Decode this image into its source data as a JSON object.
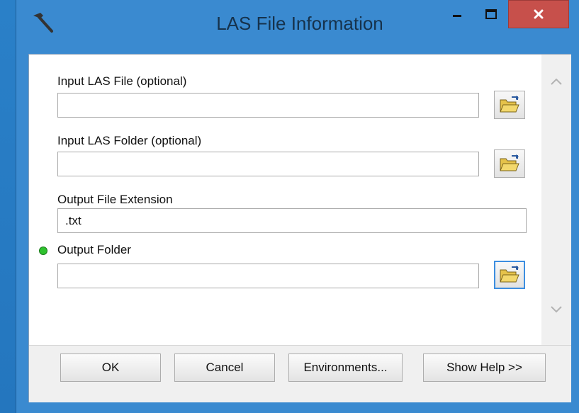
{
  "window": {
    "title": "LAS File Information"
  },
  "params": [
    {
      "label": "Input LAS File (optional)",
      "value": ""
    },
    {
      "label": "Input LAS Folder (optional)",
      "value": ""
    },
    {
      "label": "Output File Extension",
      "value": ".txt"
    },
    {
      "label": "Output Folder",
      "value": "",
      "required": true
    }
  ],
  "buttons": {
    "ok": "OK",
    "cancel": "Cancel",
    "environments": "Environments...",
    "show_help": "Show Help >>"
  },
  "icons": {
    "title": "hammer-icon",
    "browse": "open-folder-icon",
    "scroll_up": "chevron-up-icon",
    "scroll_down": "chevron-down-icon"
  },
  "colors": {
    "titlebar": "#3a8ad0",
    "close_button": "#c7504b",
    "required_dot": "#2ec22e",
    "focus_border": "#3c8ee0"
  }
}
